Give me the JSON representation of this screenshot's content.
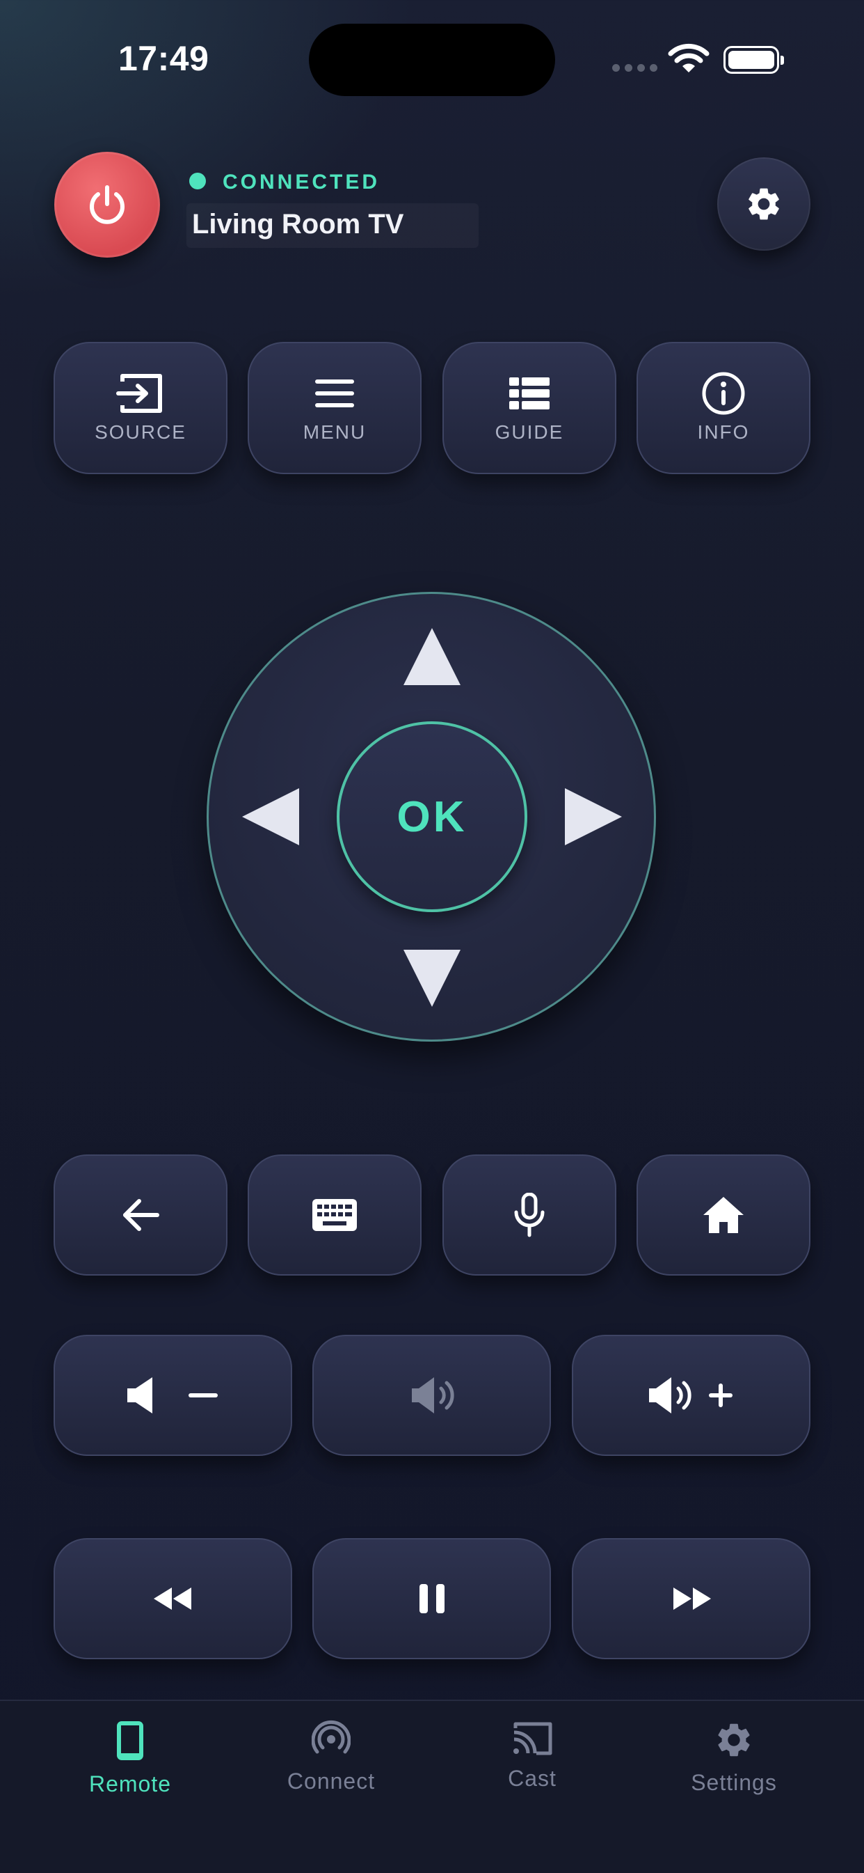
{
  "status_bar": {
    "time": "17:49",
    "battery_level": 1.0
  },
  "header": {
    "connection_status": "CONNECTED",
    "device_name": "Living Room TV",
    "power_icon": "power-icon",
    "settings_icon": "gear-icon"
  },
  "quick_buttons": [
    {
      "label": "SOURCE",
      "icon": "source-input-icon"
    },
    {
      "label": "MENU",
      "icon": "hamburger-menu-icon"
    },
    {
      "label": "GUIDE",
      "icon": "list-guide-icon"
    },
    {
      "label": "INFO",
      "icon": "info-icon"
    }
  ],
  "dpad": {
    "ok_label": "OK",
    "icons": [
      "arrow-up-icon",
      "arrow-left-icon",
      "arrow-right-icon",
      "arrow-down-icon"
    ]
  },
  "function_buttons": [
    "back-arrow-icon",
    "keyboard-icon",
    "microphone-icon",
    "home-icon"
  ],
  "volume_buttons": [
    "volume-down-icon",
    "mute-icon",
    "volume-up-icon"
  ],
  "playback_buttons": [
    "rewind-icon",
    "pause-icon",
    "fast-forward-icon"
  ],
  "tab_bar": {
    "active": "Remote",
    "tabs": [
      {
        "label": "Remote",
        "icon": "phone-icon"
      },
      {
        "label": "Connect",
        "icon": "broadcast-icon"
      },
      {
        "label": "Cast",
        "icon": "cast-icon"
      },
      {
        "label": "Settings",
        "icon": "gear-icon"
      }
    ]
  },
  "colors": {
    "background": "#161a2b",
    "accent": "#4fe3bd",
    "power_red": "#e05860",
    "button_surface": "#2a2f4a",
    "muted_text": "#aeb3c6"
  }
}
